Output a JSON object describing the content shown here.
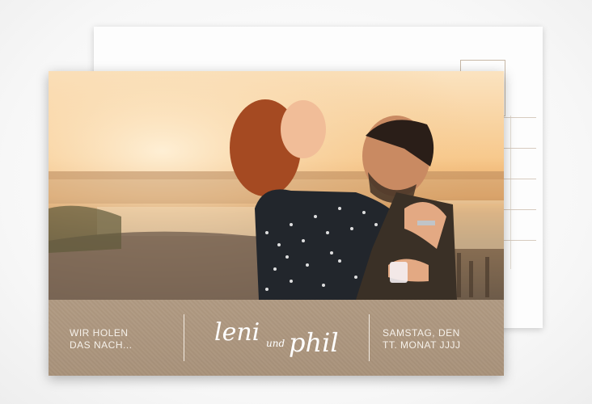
{
  "card": {
    "left_text": [
      "WIR HOLEN",
      "DAS NACH..."
    ],
    "names": {
      "first": "leni",
      "connector": "und",
      "second": "phil"
    },
    "right_text": [
      "SAMSTAG, DEN",
      "TT. MONAT JJJJ"
    ]
  },
  "colors": {
    "kraft": "#a8927a",
    "text_light": "#f6f1ea",
    "sunset": "#f7c98d"
  }
}
